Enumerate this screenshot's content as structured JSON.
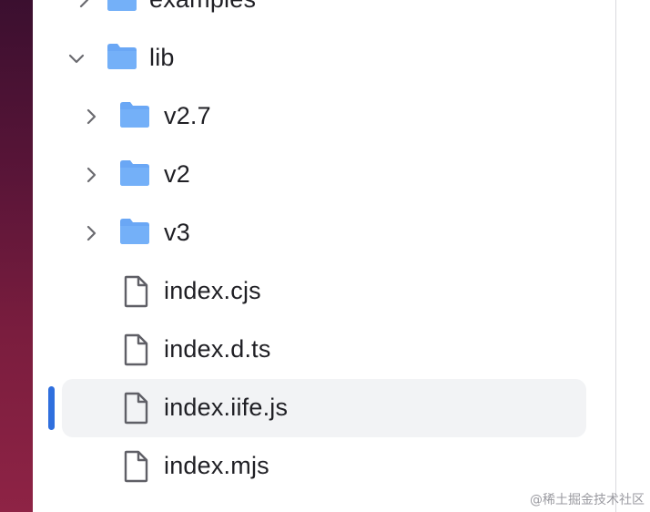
{
  "explorer": {
    "items": [
      {
        "label": "examples",
        "kind": "folder",
        "expanded": false,
        "icon": "folder-icon",
        "chevron": "chevron-right-icon"
      },
      {
        "label": "lib",
        "kind": "folder",
        "expanded": true,
        "icon": "folder-icon",
        "chevron": "chevron-down-icon"
      },
      {
        "label": "v2.7",
        "kind": "folder",
        "expanded": false,
        "icon": "folder-icon",
        "chevron": "chevron-right-icon"
      },
      {
        "label": "v2",
        "kind": "folder",
        "expanded": false,
        "icon": "folder-icon",
        "chevron": "chevron-right-icon"
      },
      {
        "label": "v3",
        "kind": "folder",
        "expanded": false,
        "icon": "folder-icon",
        "chevron": "chevron-right-icon"
      },
      {
        "label": "index.cjs",
        "kind": "file",
        "icon": "file-icon"
      },
      {
        "label": "index.d.ts",
        "kind": "file",
        "icon": "file-icon"
      },
      {
        "label": "index.iife.js",
        "kind": "file",
        "icon": "file-icon",
        "selected": true
      },
      {
        "label": "index.mjs",
        "kind": "file",
        "icon": "file-icon"
      }
    ]
  },
  "watermark": "@稀土掘金技术社区",
  "colors": {
    "folder": "#6aa7f5",
    "folder_dark": "#5a97e8",
    "selection": "#f2f3f5",
    "indicator": "#2f6fde",
    "text": "#1f1f24",
    "chevron": "#6b6b70"
  }
}
